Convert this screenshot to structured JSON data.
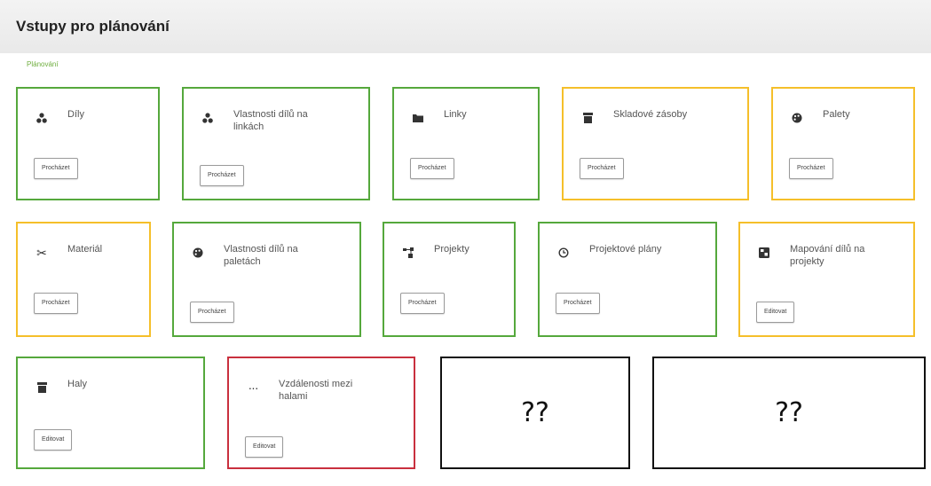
{
  "header": {
    "title": "Vstupy pro plánování"
  },
  "breadcrumb": "Plánování",
  "cards": [
    {
      "label": "Díly",
      "button": "Procházet",
      "status_color": "green",
      "icon": "parts-icon"
    },
    {
      "label": "Vlastnosti dílů na linkách",
      "button": "Procházet",
      "status_color": "green",
      "icon": "parts-icon"
    },
    {
      "label": "Linky",
      "button": "Procházet",
      "status_color": "green",
      "icon": "folder-icon"
    },
    {
      "label": "Skladové zásoby",
      "button": "Procházet",
      "status_color": "yellow",
      "icon": "archive-icon"
    },
    {
      "label": "Palety",
      "button": "Procházet",
      "status_color": "yellow",
      "icon": "palette-icon"
    },
    {
      "label": "Materiál",
      "button": "Procházet",
      "status_color": "yellow",
      "icon": "scissors-icon"
    },
    {
      "label": "Vlastnosti dílů na paletách",
      "button": "Procházet",
      "status_color": "green",
      "icon": "palette-icon"
    },
    {
      "label": "Projekty",
      "button": "Procházet",
      "status_color": "green",
      "icon": "project-icon"
    },
    {
      "label": "Projektové plány",
      "button": "Procházet",
      "status_color": "green",
      "icon": "clock-icon"
    },
    {
      "label": "Mapování dílů na projekty",
      "button": "Editovat",
      "status_color": "yellow",
      "icon": "map-icon"
    },
    {
      "label": "Haly",
      "button": "Editovat",
      "status_color": "green",
      "icon": "archive-icon"
    },
    {
      "label": "Vzdálenosti mezi halami",
      "button": "Editovat",
      "status_color": "red",
      "icon": "dots-icon"
    }
  ],
  "placeholders": [
    "??",
    "??"
  ],
  "colors": {
    "green": "#55a83c",
    "yellow": "#f5bf2a",
    "red": "#c9303e"
  }
}
